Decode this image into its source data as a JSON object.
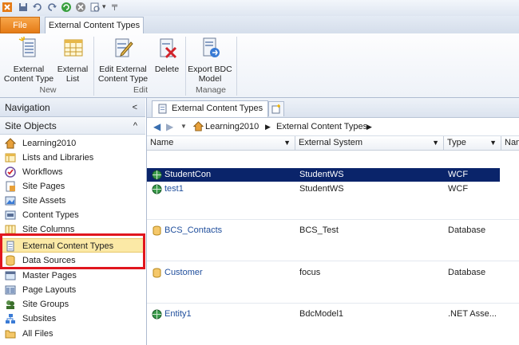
{
  "tabs": {
    "file": "File",
    "active": "External Content Types"
  },
  "ribbon": {
    "buttons": [
      {
        "label1": "External",
        "label2": "Content Type"
      },
      {
        "label1": "External",
        "label2": "List"
      },
      {
        "label1": "Edit External",
        "label2": "Content Type"
      },
      {
        "label1": "Delete",
        "label2": ""
      },
      {
        "label1": "Export BDC",
        "label2": "Model"
      }
    ],
    "groups": [
      "New",
      "Edit",
      "Manage"
    ]
  },
  "navigation": {
    "title": "Navigation",
    "collapse": "<",
    "section": "Site Objects",
    "section_chevron": "^",
    "items": [
      {
        "label": "Learning2010",
        "icon": "home-icon"
      },
      {
        "label": "Lists and Libraries",
        "icon": "lists-icon"
      },
      {
        "label": "Workflows",
        "icon": "workflow-icon"
      },
      {
        "label": "Site Pages",
        "icon": "pages-icon"
      },
      {
        "label": "Site Assets",
        "icon": "assets-icon"
      },
      {
        "label": "Content Types",
        "icon": "content-types-icon"
      },
      {
        "label": "Site Columns",
        "icon": "columns-icon"
      },
      {
        "label": "External Content Types",
        "icon": "external-content-icon"
      },
      {
        "label": "Data Sources",
        "icon": "data-sources-icon"
      },
      {
        "label": "Master Pages",
        "icon": "master-pages-icon"
      },
      {
        "label": "Page Layouts",
        "icon": "page-layouts-icon"
      },
      {
        "label": "Site Groups",
        "icon": "groups-icon"
      },
      {
        "label": "Subsites",
        "icon": "subsites-icon"
      },
      {
        "label": "All Files",
        "icon": "folder-icon"
      }
    ]
  },
  "doc_tab": {
    "label": "External Content Types"
  },
  "breadcrumb": {
    "items": [
      "Learning2010",
      "External Content Types"
    ]
  },
  "columns": [
    "Name",
    "External System",
    "Type",
    "Nam"
  ],
  "rows": [
    {
      "name": "StudentCon",
      "system": "StudentWS",
      "type": "WCF",
      "selected": true
    },
    {
      "name": "test1",
      "system": "StudentWS",
      "type": "WCF",
      "selected": false
    },
    {
      "name": "BCS_Contacts",
      "system": "BCS_Test",
      "type": "Database",
      "selected": false
    },
    {
      "name": "Customer",
      "system": "focus",
      "type": "Database",
      "selected": false
    },
    {
      "name": "Entity1",
      "system": "BdcModel1",
      "type": ".NET Asse...",
      "selected": false
    }
  ],
  "colors": {
    "accent": "#e57b16",
    "selection": "#0a246a",
    "highlight": "#fbe9a6",
    "callout": "#e1161e"
  }
}
